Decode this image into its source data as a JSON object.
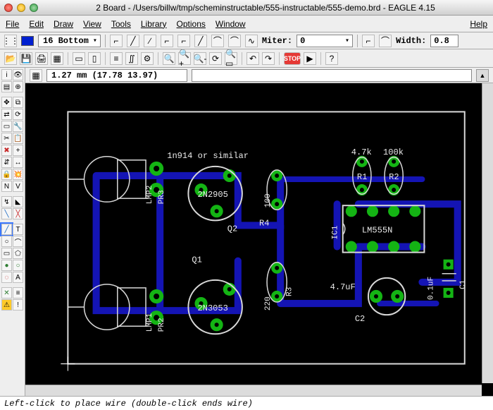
{
  "window": {
    "title": "2 Board - /Users/billw/tmp/scheminstructable/555-instructable/555-demo.brd - EAGLE 4.15"
  },
  "menu": {
    "file": "File",
    "edit": "Edit",
    "draw": "Draw",
    "view": "View",
    "tools": "Tools",
    "library": "Library",
    "options": "Options",
    "window": "Window",
    "help": "Help"
  },
  "params": {
    "layer": "16 Bottom",
    "miter_label": "Miter:",
    "miter_value": "0",
    "width_label": "Width:",
    "width_value": "0.8"
  },
  "coords": {
    "display": "1.27 mm (17.78 13.97)"
  },
  "status": {
    "hint": "Left-click to place wire (double-click ends wire)"
  },
  "board": {
    "labels": {
      "diode": "1n914 or similar",
      "q1": "Q1",
      "q1_part": "2N3053",
      "q2": "Q2",
      "q2_part": "2N2905",
      "r1": "R1",
      "r1_val": "4.7k",
      "r2": "R2",
      "r2_val": "100k",
      "r3": "R3",
      "r3_val": "220",
      "r4": "R4",
      "r4_val": "100",
      "c1": "C1",
      "c1_val": "0.1uF",
      "c2": "C2",
      "c2_val": "4.7uF",
      "ic1": "IC1",
      "ic1_part": "LM555N",
      "lmp1": "LMP1",
      "lmp2": "LMP2",
      "pr2": "PR2",
      "pr3": "PR3"
    }
  }
}
